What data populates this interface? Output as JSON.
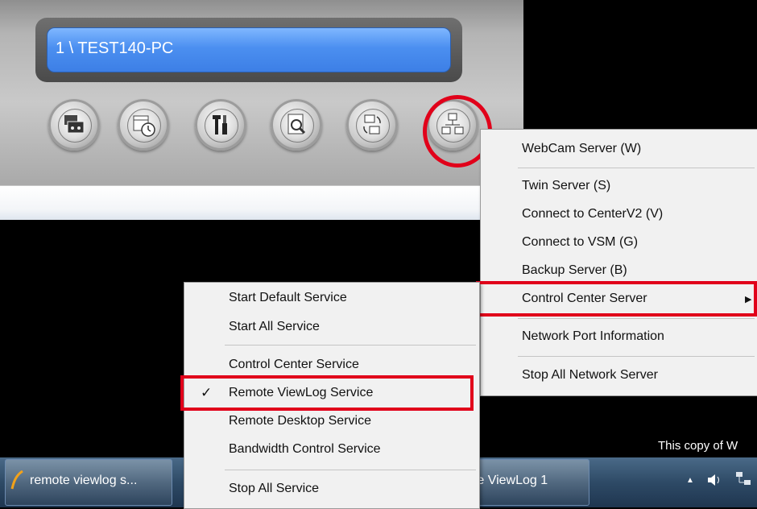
{
  "device": {
    "display_text": "1 \\ TEST140-PC"
  },
  "toolbar": {
    "buttons": [
      {
        "icon": "video-tape-icon"
      },
      {
        "icon": "schedule-clock-icon"
      },
      {
        "icon": "tools-icon"
      },
      {
        "icon": "log-search-icon"
      },
      {
        "icon": "sync-icon"
      },
      {
        "icon": "network-server-icon"
      }
    ]
  },
  "network_menu": {
    "items": [
      "WebCam Server (W)",
      "Twin Server (S)",
      "Connect to CenterV2 (V)",
      "Connect to VSM (G)",
      "Backup Server (B)",
      "Control Center Server",
      "Network Port Information",
      "Stop All Network Server"
    ]
  },
  "control_center_submenu": {
    "items": [
      "Start Default Service",
      "Start All Service",
      "Control Center Service",
      "Remote ViewLog Service",
      "Remote Desktop Service",
      "Bandwidth Control Service",
      "Stop All Service"
    ],
    "checked_item": "Remote ViewLog Service",
    "check_mark": "✓"
  },
  "taskbar": {
    "button_1": "remote viewlog s...",
    "button_2": "ote ViewLog 1",
    "tray_arrow": "▲"
  },
  "watermark": "This copy of W",
  "colors": {
    "highlight_red": "#e1001a",
    "display_blue": "#4b8ff0"
  }
}
